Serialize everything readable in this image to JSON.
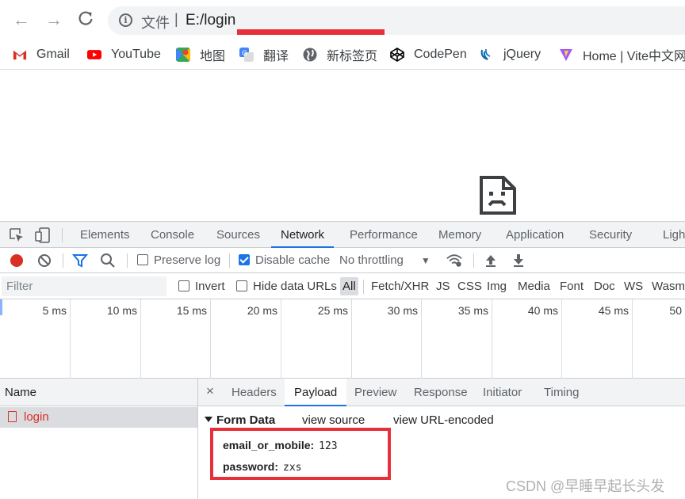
{
  "browser": {
    "back_icon": "arrow-left-icon",
    "forward_icon": "arrow-right-icon",
    "reload_icon": "reload-icon",
    "address": {
      "info_icon": "info-icon",
      "scheme_label": "文件",
      "separator": "|",
      "url": "E:/login"
    }
  },
  "bookmarks": [
    {
      "label": "Gmail",
      "icon": "gmail-icon",
      "color": "#d93025"
    },
    {
      "label": "YouTube",
      "icon": "youtube-icon",
      "color": "#ff0000"
    },
    {
      "label": "地图",
      "icon": "maps-icon",
      "color": "#34a853"
    },
    {
      "label": "翻译",
      "icon": "translate-icon",
      "color": "#4285f4"
    },
    {
      "label": "新标签页",
      "icon": "globe-icon",
      "color": "#5f6368"
    },
    {
      "label": "CodePen",
      "icon": "codepen-icon",
      "color": "#000000"
    },
    {
      "label": "jQuery",
      "icon": "jquery-icon",
      "color": "#0769ad"
    },
    {
      "label": "Home | Vite中文网",
      "icon": "vite-icon",
      "color": "#a259ff"
    }
  ],
  "page": {
    "error_icon": "sad-document-icon"
  },
  "devtools": {
    "tabs": [
      "Elements",
      "Console",
      "Sources",
      "Network",
      "Performance",
      "Memory",
      "Application",
      "Security",
      "Ligh"
    ],
    "active_tab": "Network",
    "toolbar": {
      "preserve_log": "Preserve log",
      "disable_cache": "Disable cache",
      "throttling": "No throttling"
    },
    "filter": {
      "placeholder": "Filter",
      "invert": "Invert",
      "hide_data_urls": "Hide data URLs",
      "types": [
        "All",
        "Fetch/XHR",
        "JS",
        "CSS",
        "Img",
        "Media",
        "Font",
        "Doc",
        "WS",
        "Wasm"
      ]
    },
    "timeline_ticks": [
      "5 ms",
      "10 ms",
      "15 ms",
      "20 ms",
      "25 ms",
      "30 ms",
      "35 ms",
      "40 ms",
      "45 ms",
      "50"
    ],
    "requests": {
      "header": "Name",
      "rows": [
        "login"
      ]
    },
    "detail": {
      "close": "×",
      "tabs": [
        "Headers",
        "Payload",
        "Preview",
        "Response",
        "Initiator",
        "Timing"
      ],
      "active_tab": "Payload",
      "form_data": {
        "title": "Form Data",
        "view_source": "view source",
        "view_url_encoded": "view URL-encoded",
        "fields": [
          {
            "key": "email_or_mobile:",
            "value": "123"
          },
          {
            "key": "password:",
            "value": "zxs"
          }
        ]
      }
    }
  },
  "watermark": "CSDN @早睡早起长头发"
}
